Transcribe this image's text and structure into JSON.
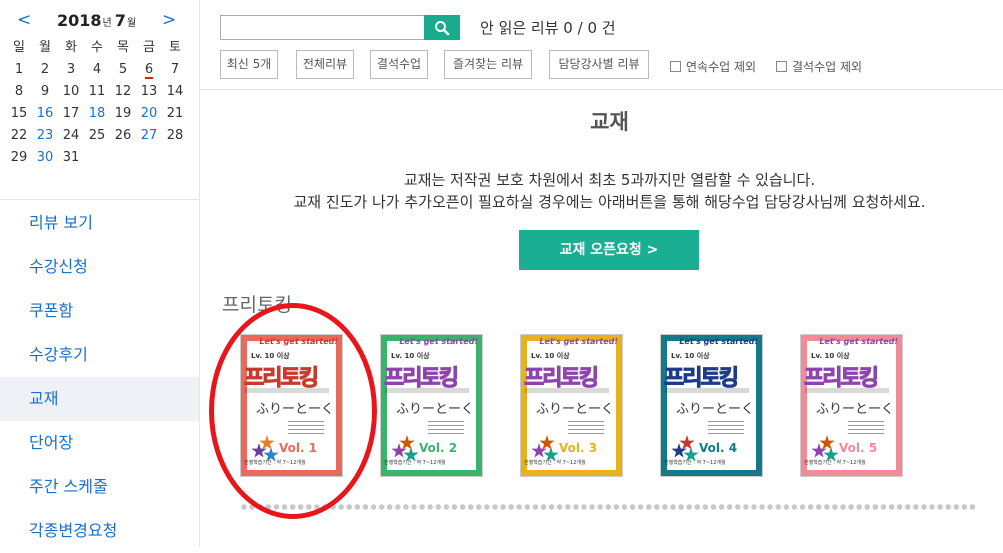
{
  "calendar": {
    "prev": "<",
    "next": ">",
    "year": "2018",
    "year_unit": "년",
    "month": "7",
    "month_unit": "월",
    "weekdays": [
      "일",
      "월",
      "화",
      "수",
      "목",
      "금",
      "토"
    ],
    "weeks": [
      [
        "1",
        "2",
        "3",
        "4",
        "5",
        "6",
        "7"
      ],
      [
        "8",
        "9",
        "10",
        "11",
        "12",
        "13",
        "14"
      ],
      [
        "15",
        "16",
        "17",
        "18",
        "19",
        "20",
        "21"
      ],
      [
        "22",
        "23",
        "24",
        "25",
        "26",
        "27",
        "28"
      ],
      [
        "29",
        "30",
        "31",
        "",
        "",
        "",
        ""
      ]
    ],
    "highlighted_days": [
      "16",
      "18",
      "20",
      "23",
      "27",
      "30"
    ],
    "today": "6"
  },
  "sidebar": {
    "items": [
      {
        "label": "리뷰 보기"
      },
      {
        "label": "수강신청"
      },
      {
        "label": "쿠폰함"
      },
      {
        "label": "수강후기"
      },
      {
        "label": "교재",
        "active": true
      },
      {
        "label": "단어장"
      },
      {
        "label": "주간 스케줄"
      },
      {
        "label": "각종변경요청"
      }
    ]
  },
  "search": {
    "placeholder": "",
    "value": ""
  },
  "unread": "안 읽은 리뷰 0 / 0 건",
  "filters": {
    "buttons": [
      "최신 5개",
      "전체리뷰",
      "결석수업",
      "즐겨찾는 리뷰",
      "담당강사별 리뷰"
    ],
    "checkboxes": [
      "연속수업 제외",
      "결석수업 제외"
    ]
  },
  "page": {
    "title": "교재",
    "notice_line1": "교재는 저작권 보호 차원에서 최초 5과까지만 열람할 수 있습니다.",
    "notice_line2": "교재 진도가 나가 추가오픈이 필요하실 경우에는 아래버튼을 통해 해당수업 담당강사님께 요청하세요.",
    "open_button": "교재 오픈요청 >"
  },
  "section": {
    "title": "프리토킹"
  },
  "books": [
    {
      "ribbon": "Let's get started!",
      "lv": "Lv. 10 이상",
      "brand": "프리토킹",
      "kana": "ふりーとーく",
      "vol": "Vol. 1",
      "period": "진행학습기간 : 약 7~12개월",
      "color": "#e86a5c",
      "accent": "#c73b2e"
    },
    {
      "ribbon": "Let's get started!",
      "lv": "Lv. 10 이상",
      "brand": "프리토킹",
      "kana": "ふりーとーく",
      "vol": "Vol. 2",
      "period": "진행학습기간 : 약 7~12개월",
      "color": "#3cb36a",
      "accent": "#8e44ad"
    },
    {
      "ribbon": "Let's get started!",
      "lv": "Lv. 10 이상",
      "brand": "프리토킹",
      "kana": "ふりーとーく",
      "vol": "Vol. 3",
      "period": "진행학습기간 : 약 7~12개월",
      "color": "#e8b21c",
      "accent": "#8e44ad"
    },
    {
      "ribbon": "Let's get started!",
      "lv": "Lv. 10 이상",
      "brand": "프리토킹",
      "kana": "ふりーとーく",
      "vol": "Vol. 4",
      "period": "진행학습기간 : 약 7~12개월",
      "color": "#137a8a",
      "accent": "#1e3a8a"
    },
    {
      "ribbon": "Let's get started!",
      "lv": "Lv. 10 이상",
      "brand": "프리토킹",
      "kana": "ふりーとーく",
      "vol": "Vol. 5",
      "period": "진행학습기간 : 약 7~12개월",
      "color": "#f08c98",
      "accent": "#8e44ad"
    }
  ],
  "colors": {
    "accent": "#1aaf93",
    "link": "#1a6fc9",
    "highlight_circle": "#e8161a"
  }
}
